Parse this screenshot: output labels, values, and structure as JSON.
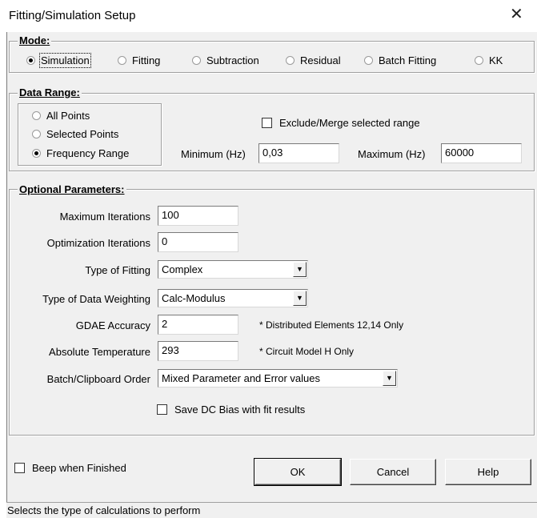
{
  "window": {
    "title": "Fitting/Simulation Setup",
    "close_glyph": "✕"
  },
  "mode": {
    "title": "Mode:",
    "options": [
      {
        "label": "Simulation",
        "selected": true
      },
      {
        "label": "Fitting",
        "selected": false
      },
      {
        "label": "Subtraction",
        "selected": false
      },
      {
        "label": "Residual",
        "selected": false
      },
      {
        "label": "Batch Fitting",
        "selected": false
      },
      {
        "label": "KK",
        "selected": false
      }
    ]
  },
  "data_range": {
    "title": "Data Range:",
    "options": [
      {
        "label": "All Points",
        "selected": false
      },
      {
        "label": "Selected Points",
        "selected": false
      },
      {
        "label": "Frequency Range",
        "selected": true
      }
    ],
    "exclude_label": "Exclude/Merge selected range",
    "exclude_checked": false,
    "min_label": "Minimum (Hz)",
    "min_value": "0,03",
    "max_label": "Maximum (Hz)",
    "max_value": "60000"
  },
  "optional": {
    "title": "Optional Parameters:",
    "max_iter_label": "Maximum Iterations",
    "max_iter_value": "100",
    "opt_iter_label": "Optimization Iterations",
    "opt_iter_value": "0",
    "fit_type_label": "Type of Fitting",
    "fit_type_value": "Complex",
    "weighting_label": "Type of Data Weighting",
    "weighting_value": "Calc-Modulus",
    "gdae_label": "GDAE Accuracy",
    "gdae_value": "2",
    "gdae_note": "* Distributed Elements 12,14 Only",
    "temp_label": "Absolute Temperature",
    "temp_value": "293",
    "temp_note": "* Circuit Model H Only",
    "batch_label": "Batch/Clipboard Order",
    "batch_value": "Mixed Parameter and Error values",
    "dc_bias_label": "Save DC Bias with fit results",
    "dc_bias_checked": false
  },
  "footer": {
    "beep_label": "Beep when Finished",
    "beep_checked": false,
    "ok_label": "OK",
    "cancel_label": "Cancel",
    "help_label": "Help"
  },
  "status": {
    "text": "Selects the type of calculations to perform"
  },
  "icons": {
    "dropdown_arrow": "▼"
  }
}
